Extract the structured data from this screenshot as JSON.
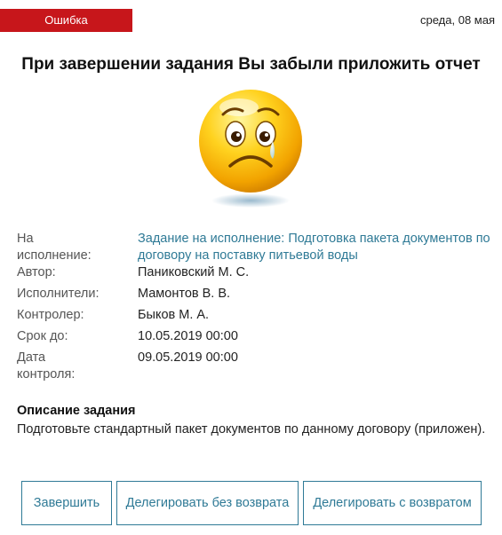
{
  "header": {
    "badge": "Ошибка",
    "date": "среда, 08 мая",
    "badge_color": "#c7161b"
  },
  "title": "При завершении задания Вы забыли приложить отчет",
  "illustration": "sad-smiley-icon",
  "details": {
    "assignment_label": "На исполнение:",
    "assignment_value": "Задание на исполнение: Подготовка пакета документов по договору на поставку питьевой воды",
    "author_label": "Автор:",
    "author_value": "Паниковский М. С.",
    "executors_label": "Исполнители:",
    "executors_value": "Мамонтов В. В.",
    "controller_label": "Контролер:",
    "controller_value": "Быков М. А.",
    "deadline_label": "Срок до:",
    "deadline_value": "10.05.2019 00:00",
    "control_date_label": "Дата контроля:",
    "control_date_value": "09.05.2019 00:00"
  },
  "description": {
    "title": "Описание задания",
    "text": "Подготовьте стандартный пакет документов по данному договору (приложен)."
  },
  "buttons": {
    "complete": "Завершить",
    "delegate_no_return": "Делегировать без возврата",
    "delegate_return": "Делегировать с возвратом"
  },
  "colors": {
    "accent": "#2f7a96",
    "error": "#c7161b"
  }
}
